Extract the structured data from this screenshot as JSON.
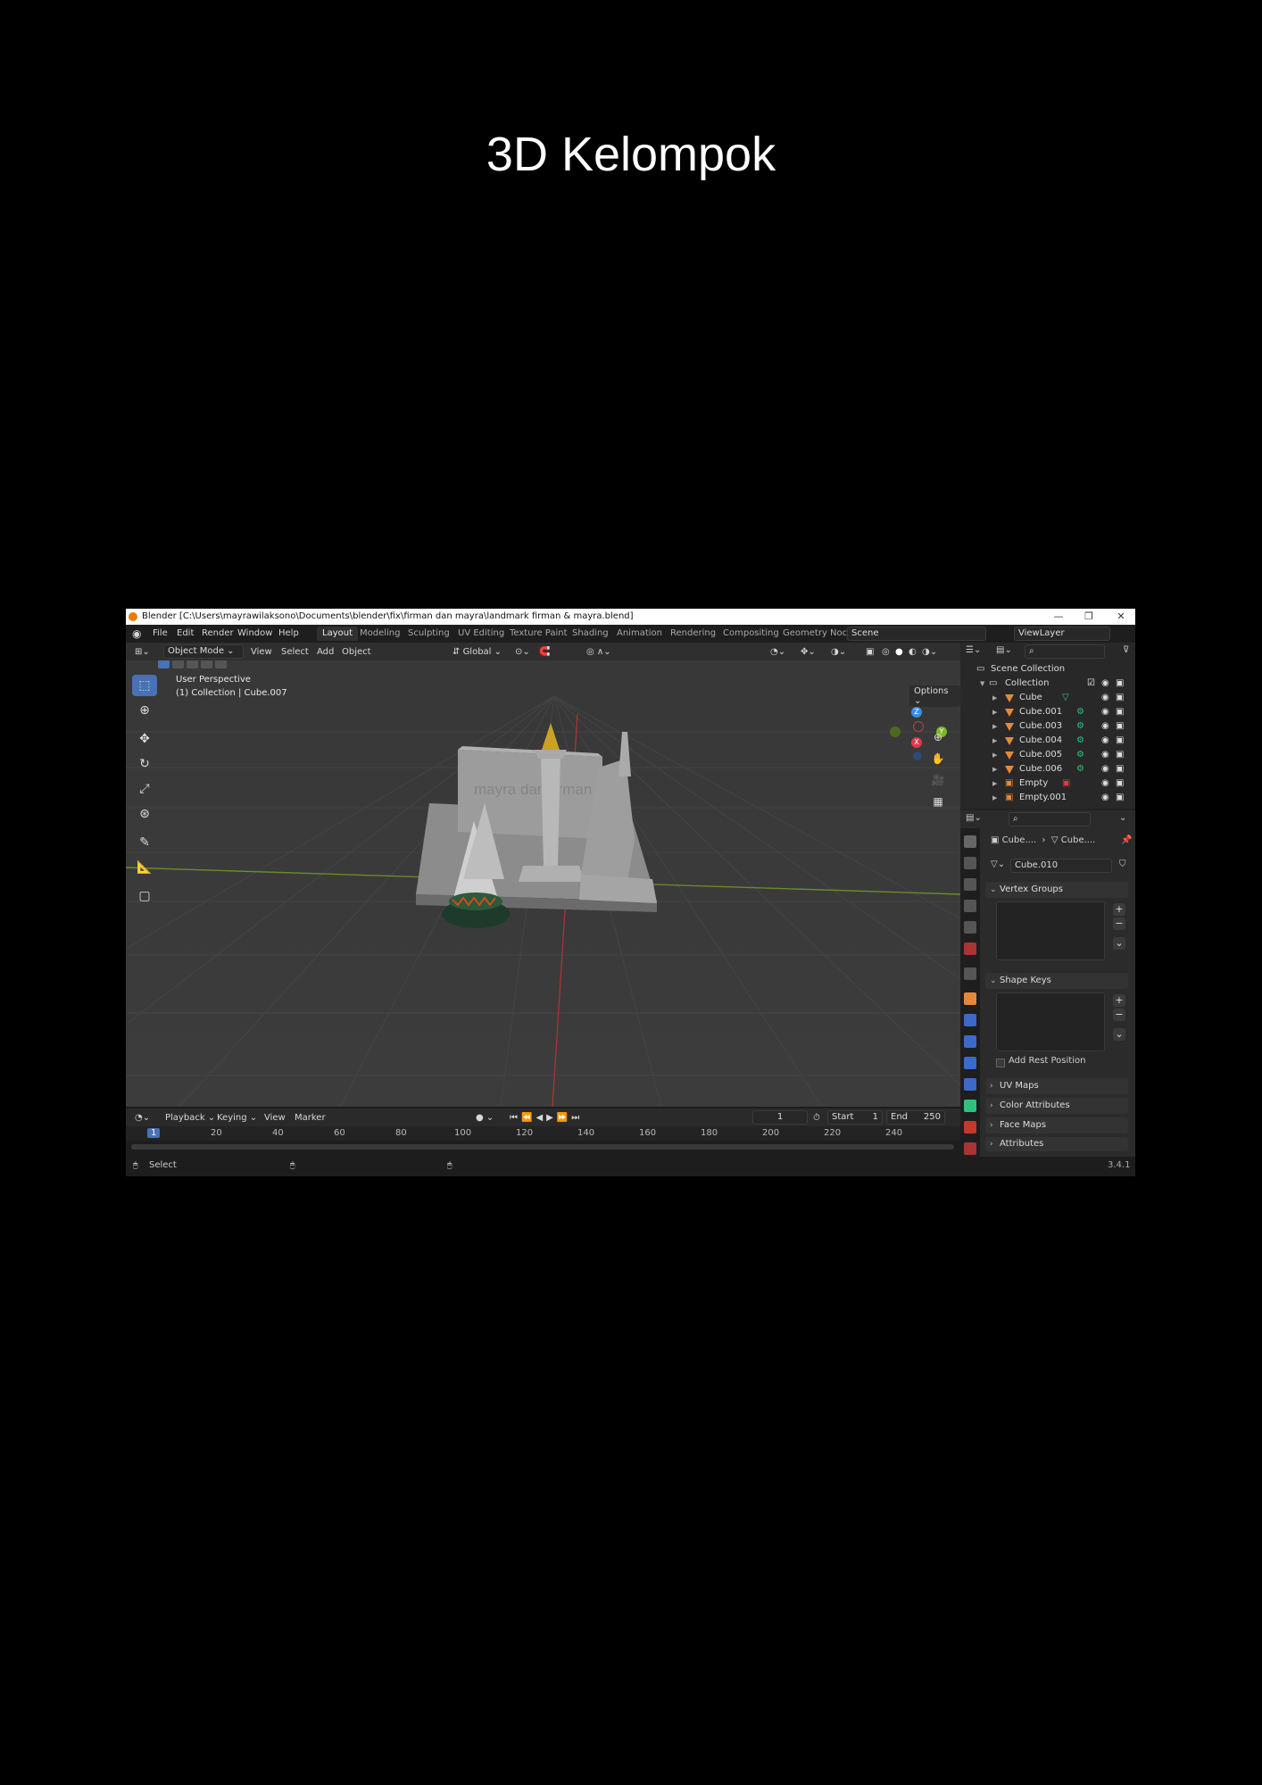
{
  "page": {
    "title": "3D Kelompok"
  },
  "window": {
    "title": "Blender [C:\\Users\\mayrawilaksono\\Documents\\blender\\fix\\firman dan mayra\\landmark firman & mayra.blend]",
    "minimize": "—",
    "maximize": "❐",
    "close": "✕"
  },
  "menu": {
    "items": [
      "File",
      "Edit",
      "Render",
      "Window",
      "Help"
    ],
    "workspaces": [
      "Layout",
      "Modeling",
      "Sculpting",
      "UV Editing",
      "Texture Paint",
      "Shading",
      "Animation",
      "Rendering",
      "Compositing",
      "Geometry Noc"
    ],
    "active_workspace": "Layout",
    "scene": "Scene",
    "view_layer": "ViewLayer"
  },
  "viewport_header": {
    "mode": "Object Mode",
    "menus": [
      "View",
      "Select",
      "Add",
      "Object"
    ],
    "orientation": "Global",
    "options": "Options"
  },
  "viewport": {
    "perspective_label": "User Perspective",
    "collection_label": "(1) Collection | Cube.007",
    "model_text": "mayra dan firman",
    "axis_x": "X",
    "axis_y": "Y",
    "axis_z": "Z"
  },
  "timeline": {
    "menus": [
      "Playback",
      "Keying",
      "View",
      "Marker"
    ],
    "current_frame": "1",
    "start_label": "Start",
    "start_value": "1",
    "end_label": "End",
    "end_value": "250",
    "ruler": [
      "1",
      "20",
      "40",
      "60",
      "80",
      "100",
      "120",
      "140",
      "160",
      "180",
      "200",
      "220",
      "240"
    ]
  },
  "status": {
    "select": "Select",
    "version": "3.4.1"
  },
  "outliner": {
    "root": "Scene Collection",
    "collection": "Collection",
    "items": [
      "Cube",
      "Cube.001",
      "Cube.003",
      "Cube.004",
      "Cube.005",
      "Cube.006",
      "Empty",
      "Empty.001"
    ]
  },
  "properties": {
    "breadcrumb_object": "Cube....",
    "breadcrumb_data": "Cube....",
    "mesh_name": "Cube.010",
    "panels": {
      "vertex_groups": "Vertex Groups",
      "shape_keys": "Shape Keys",
      "add_rest_position": "Add Rest Position",
      "uv_maps": "UV Maps",
      "color_attributes": "Color Attributes",
      "face_maps": "Face Maps",
      "attributes": "Attributes"
    }
  },
  "colors": {
    "accent": "#4772b3",
    "active_object_orange": "#e38a3a",
    "axis_red": "#e0374f",
    "axis_green": "#7ab922",
    "axis_blue": "#3b8ee6"
  }
}
